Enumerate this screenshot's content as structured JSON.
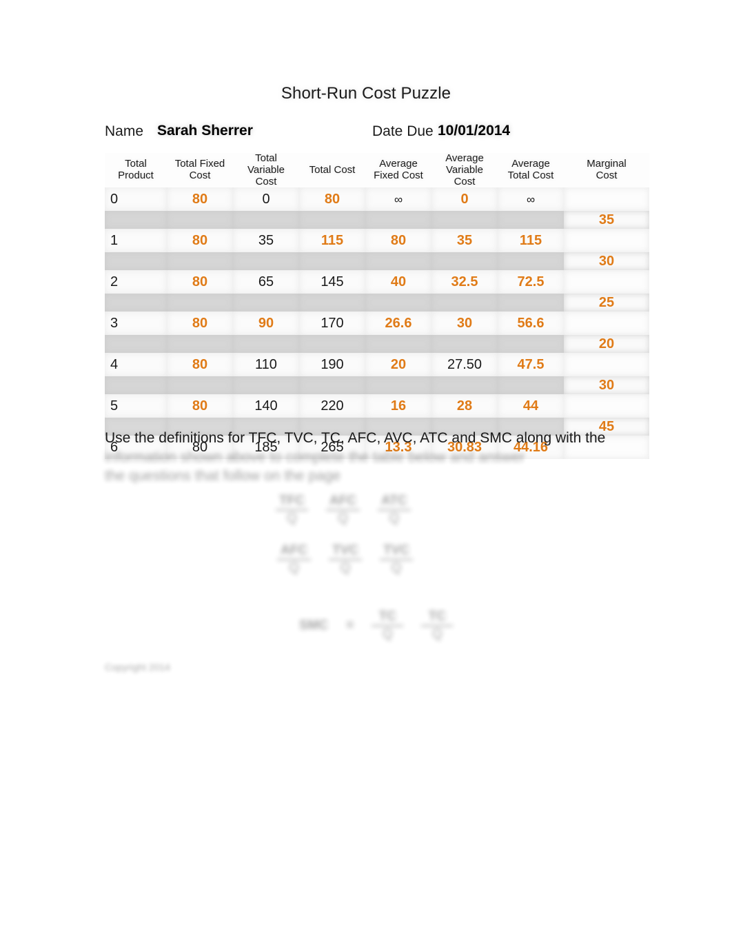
{
  "document": {
    "title": "Short-Run Cost Puzzle"
  },
  "header_fields": {
    "name_label": "Name",
    "name_value": "Sarah Sherrer",
    "date_label": "Date Due",
    "date_value": "10/01/2014"
  },
  "table": {
    "columns": [
      {
        "key": "tp",
        "header": "Total\nProduct"
      },
      {
        "key": "tfc",
        "header": "Total Fixed\nCost"
      },
      {
        "key": "tvc",
        "header": "Total\nVariable\nCost"
      },
      {
        "key": "tc",
        "header": "Total Cost"
      },
      {
        "key": "afc",
        "header": "Average\nFixed Cost"
      },
      {
        "key": "avc",
        "header": "Average\nVariable\nCost"
      },
      {
        "key": "atc",
        "header": "Average\nTotal Cost"
      },
      {
        "key": "mc",
        "header": "Marginal\nCost"
      }
    ],
    "headers": {
      "total_product_l1": "Total",
      "total_product_l2": "Product",
      "total_fixed_cost_l1": "Total Fixed",
      "total_fixed_cost_l2": "Cost",
      "total_variable_cost_l1": "Total",
      "total_variable_cost_l2": "Variable",
      "total_variable_cost_l3": "Cost",
      "total_cost_l1": "Total Cost",
      "average_fixed_cost_l1": "Average",
      "average_fixed_cost_l2": "Fixed Cost",
      "average_variable_cost_l1": "Average",
      "average_variable_cost_l2": "Variable",
      "average_variable_cost_l3": "Cost",
      "average_total_cost_l1": "Average",
      "average_total_cost_l2": "Total Cost",
      "marginal_cost_l1": "Marginal",
      "marginal_cost_l2": "Cost"
    },
    "rows": [
      {
        "tp": {
          "text": "0",
          "style": "given"
        },
        "tfc": {
          "text": "80",
          "style": "answer"
        },
        "tvc": {
          "text": "0",
          "style": "given"
        },
        "tc": {
          "text": "80",
          "style": "answer"
        },
        "afc": {
          "text": "∞",
          "style": "inf"
        },
        "avc": {
          "text": "0",
          "style": "answer"
        },
        "atc": {
          "text": "∞",
          "style": "inf"
        }
      },
      {
        "tp": {
          "text": "1",
          "style": "given"
        },
        "tfc": {
          "text": "80",
          "style": "answer"
        },
        "tvc": {
          "text": "35",
          "style": "given"
        },
        "tc": {
          "text": "115",
          "style": "answer"
        },
        "afc": {
          "text": "80",
          "style": "answer"
        },
        "avc": {
          "text": "35",
          "style": "answer"
        },
        "atc": {
          "text": "115",
          "style": "answer"
        }
      },
      {
        "tp": {
          "text": "2",
          "style": "given"
        },
        "tfc": {
          "text": "80",
          "style": "answer"
        },
        "tvc": {
          "text": "65",
          "style": "given"
        },
        "tc": {
          "text": "145",
          "style": "given"
        },
        "afc": {
          "text": "40",
          "style": "answer"
        },
        "avc": {
          "text": "32.5",
          "style": "answer"
        },
        "atc": {
          "text": "72.5",
          "style": "answer"
        }
      },
      {
        "tp": {
          "text": "3",
          "style": "given"
        },
        "tfc": {
          "text": "80",
          "style": "answer"
        },
        "tvc": {
          "text": "90",
          "style": "answer"
        },
        "tc": {
          "text": "170",
          "style": "given"
        },
        "afc": {
          "text": "26.6",
          "style": "answer"
        },
        "avc": {
          "text": "30",
          "style": "answer"
        },
        "atc": {
          "text": "56.6",
          "style": "answer"
        }
      },
      {
        "tp": {
          "text": "4",
          "style": "given"
        },
        "tfc": {
          "text": "80",
          "style": "answer"
        },
        "tvc": {
          "text": "110",
          "style": "given"
        },
        "tc": {
          "text": "190",
          "style": "given"
        },
        "afc": {
          "text": "20",
          "style": "answer"
        },
        "avc": {
          "text": "27.50",
          "style": "given"
        },
        "atc": {
          "text": "47.5",
          "style": "answer"
        }
      },
      {
        "tp": {
          "text": "5",
          "style": "given"
        },
        "tfc": {
          "text": "80",
          "style": "answer"
        },
        "tvc": {
          "text": "140",
          "style": "given"
        },
        "tc": {
          "text": "220",
          "style": "given"
        },
        "afc": {
          "text": "16",
          "style": "answer"
        },
        "avc": {
          "text": "28",
          "style": "answer"
        },
        "atc": {
          "text": "44",
          "style": "answer"
        }
      },
      {
        "tp": {
          "text": "6",
          "style": "given"
        },
        "tfc": {
          "text": "80",
          "style": "given"
        },
        "tvc": {
          "text": "185",
          "style": "given"
        },
        "tc": {
          "text": "265",
          "style": "given"
        },
        "afc": {
          "text": "13.3",
          "style": "answer"
        },
        "avc": {
          "text": "30.83",
          "style": "answer"
        },
        "atc": {
          "text": "44.16",
          "style": "answer"
        }
      }
    ],
    "marginal_costs": [
      {
        "text": "35",
        "style": "mc"
      },
      {
        "text": "30",
        "style": "mc"
      },
      {
        "text": "25",
        "style": "mc"
      },
      {
        "text": "20",
        "style": "mc"
      },
      {
        "text": "30",
        "style": "mc"
      },
      {
        "text": "45",
        "style": "mc"
      }
    ]
  },
  "instructions": {
    "line1": "Use the definitions for TFC, TVC, TC, AFC, AVC, ATC and SMC along with the",
    "line2_blurred": "information shown above to complete the table below and answer",
    "line3_blurred": "the questions that follow on the page"
  },
  "formulas": {
    "group1": {
      "t1_num": "TFC",
      "t1_den": "Q",
      "t2_num": "AFC",
      "t2_den": "Q",
      "t3_num": "ATC",
      "t3_den": "Q"
    },
    "group2": {
      "t1_num": "AFC",
      "t1_den": "Q",
      "t2_num": "TVC",
      "t2_den": "Q",
      "t3_num": "TVC",
      "t3_den": "Q"
    },
    "group3": {
      "lhs": "SMC",
      "eq": "=",
      "t1_num": "TC",
      "t1_den": "Q",
      "t2_num": "TC",
      "t2_den": "Q"
    }
  },
  "footer": {
    "note_blurred": "Copyright 2014"
  },
  "colors": {
    "answer_orange": "#e07b17",
    "text_black": "#1a1a1a",
    "row_band_gray": "#d6d6d6",
    "row_light": "#fbfbfb"
  }
}
